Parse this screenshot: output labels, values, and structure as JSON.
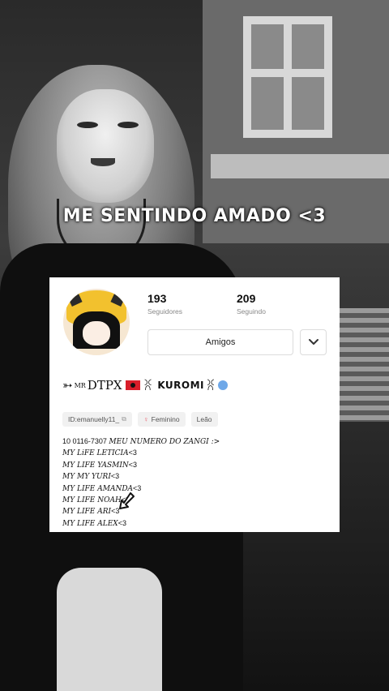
{
  "caption": "ME SENTINDO AMADO <3",
  "profile": {
    "followers": {
      "count": "193",
      "label": "Seguidores"
    },
    "following": {
      "count": "209",
      "label": "Seguindo"
    },
    "friends_button": "Amigos",
    "nickname": {
      "prefix": "➳",
      "sup": "MR",
      "main": "DTPX",
      "kuromi": "KUROMI",
      "suffix": "ꐦ"
    },
    "tags": {
      "id": "ID:emanuelly11_",
      "gender": "Feminino",
      "sign": "Leão"
    },
    "bio": [
      {
        "a": "10 0116-7307 ",
        "b": "MEU NUMERO DO ZANGI :>"
      },
      {
        "a": "MY LiFE  LETICIA",
        "b": "<3"
      },
      {
        "a": "MY LIFE YASMIN",
        "b": "<3"
      },
      {
        "a": "MY MY YURI",
        "b": "<3"
      },
      {
        "a": "MY LIFE AMANDA",
        "b": "<3"
      },
      {
        "a": "MY LIFE NOAH",
        "b": "<3"
      },
      {
        "a": "MY LIFE ARI",
        "b": "<3"
      },
      {
        "a": "MY LIFE  ALEX",
        "b": "<3"
      }
    ]
  },
  "icons": [
    "chevron-down-icon",
    "copy-icon",
    "female-icon",
    "verified-icon",
    "cursor-arrow-icon"
  ]
}
